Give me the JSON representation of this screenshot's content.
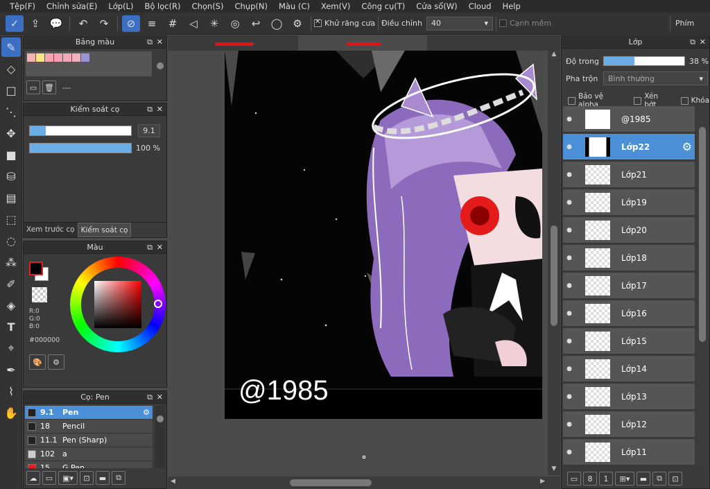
{
  "menu": [
    "Tệp(F)",
    "Chỉnh sửa(E)",
    "Lớp(L)",
    "Bộ lọc(R)",
    "Chọn(S)",
    "Chụp(N)",
    "Màu (C)",
    "Xem(V)",
    "Công cụ(T)",
    "Cửa sổ(W)",
    "Cloud",
    "Help"
  ],
  "toolbar": {
    "antialias_label": "Khử răng cưa",
    "adjust_label": "Điều chỉnh",
    "adjust_value": "40",
    "sharp_edge_label": "Cạnh mềm",
    "keys_label": "Phím"
  },
  "palette_panel": {
    "title": "Bảng màu",
    "swatches": [
      "#f5b4b4",
      "#f8e58a",
      "#f7a3b0",
      "#f5a0b5",
      "#f2a8b8",
      "#f0b0c0",
      "#9a94d6"
    ],
    "footer_text": "---"
  },
  "brush_control": {
    "title": "Kiểm soát cọ",
    "size_value": "9.1",
    "opacity_value": "100 %",
    "size_fraction": 0.16,
    "opacity_fraction": 1.0,
    "tab_preview": "Xem trước cọ",
    "tab_control": "Kiểm soát cọ"
  },
  "color_panel": {
    "title": "Màu",
    "r": "R:0",
    "g": "G:0",
    "b": "B:0",
    "hex": "#000000"
  },
  "brush_list": {
    "title": "Cọ: Pen",
    "items": [
      {
        "size": "9.1",
        "name": "Pen",
        "color": "#222222"
      },
      {
        "size": "18",
        "name": "Pencil",
        "color": "#222222"
      },
      {
        "size": "11.1",
        "name": "Pen (Sharp)",
        "color": "#222222"
      },
      {
        "size": "102",
        "name": "a",
        "color": "#cccccc"
      },
      {
        "size": "15",
        "name": "G Pen",
        "color": "#e02020"
      }
    ]
  },
  "canvas": {
    "watermark": "@1985"
  },
  "layer_panel": {
    "title": "Lớp",
    "opacity_label": "Độ trong",
    "opacity_value": "38 %",
    "opacity_fraction": 0.38,
    "blend_label": "Pha trộn",
    "blend_value": "Bình thường",
    "protect_alpha": "Bảo vệ alpha",
    "clipping": "Xén bớt",
    "lock": "Khóa",
    "layers": [
      "@1985",
      "Lớp22",
      "Lớp21",
      "Lớp19",
      "Lớp20",
      "Lớp18",
      "Lớp17",
      "Lớp16",
      "Lớp15",
      "Lớp14",
      "Lớp13",
      "Lớp12",
      "Lớp11"
    ]
  }
}
